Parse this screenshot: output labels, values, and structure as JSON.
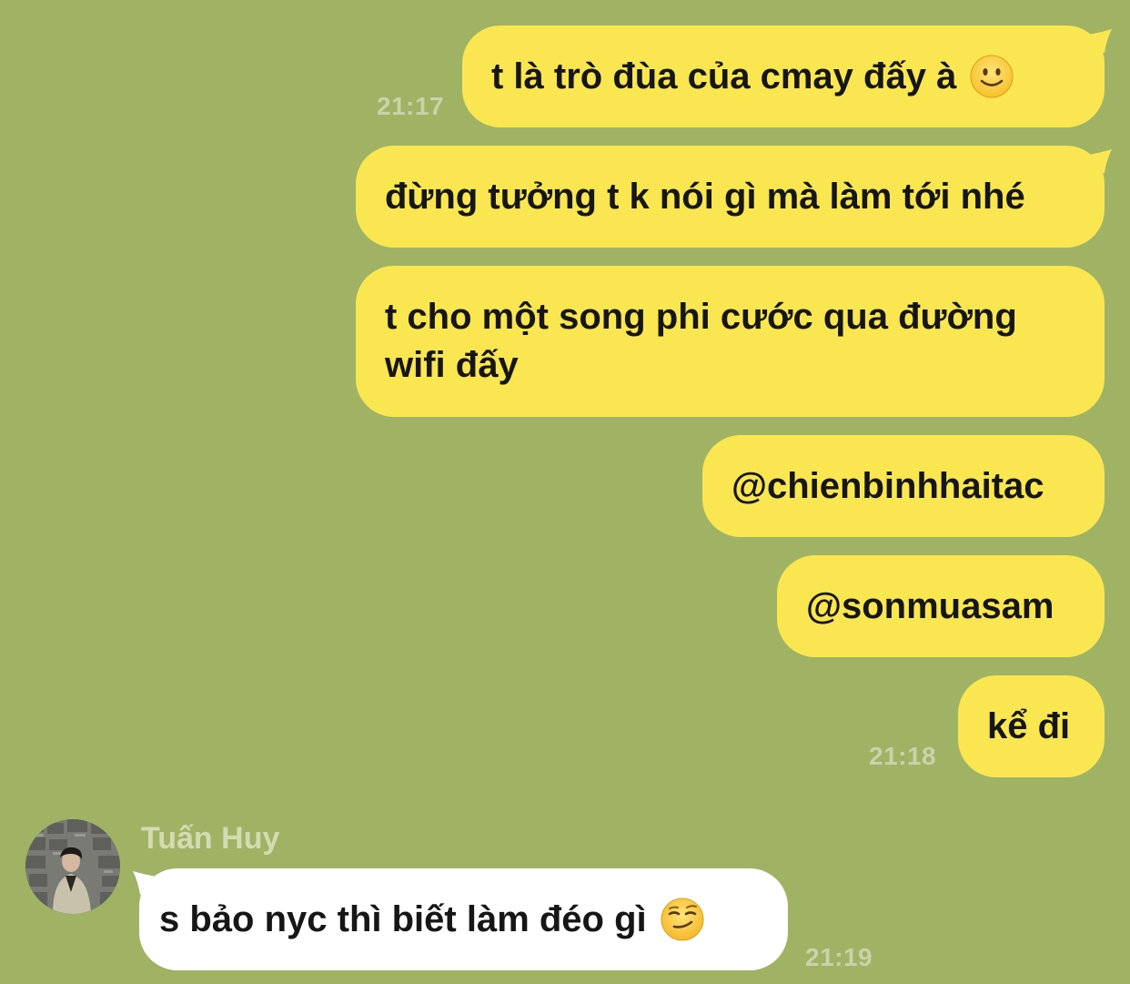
{
  "messages": [
    {
      "text": "t là trò đùa của cmay đấy à",
      "emoji": "slightly-smiling-face-emoji",
      "time": "21:17"
    },
    {
      "text": "đừng tưởng t k nói gì mà làm tới nhé"
    },
    {
      "text": "t cho một song phi cước qua đường wifi đấy"
    },
    {
      "text": "@chienbinhhaitac"
    },
    {
      "text": "@sonmuasam"
    },
    {
      "text": "kể đi",
      "time": "21:18"
    }
  ],
  "reply": {
    "sender": "Tuấn Huy",
    "text": "s bảo nyc thì biết làm đéo gì",
    "emoji": "smirking-face-emoji",
    "time": "21:19"
  },
  "colors": {
    "background": "#a0b264",
    "sent_bubble": "#f9e650",
    "received_bubble": "#ffffff",
    "timestamp": "#c9d2a8"
  }
}
